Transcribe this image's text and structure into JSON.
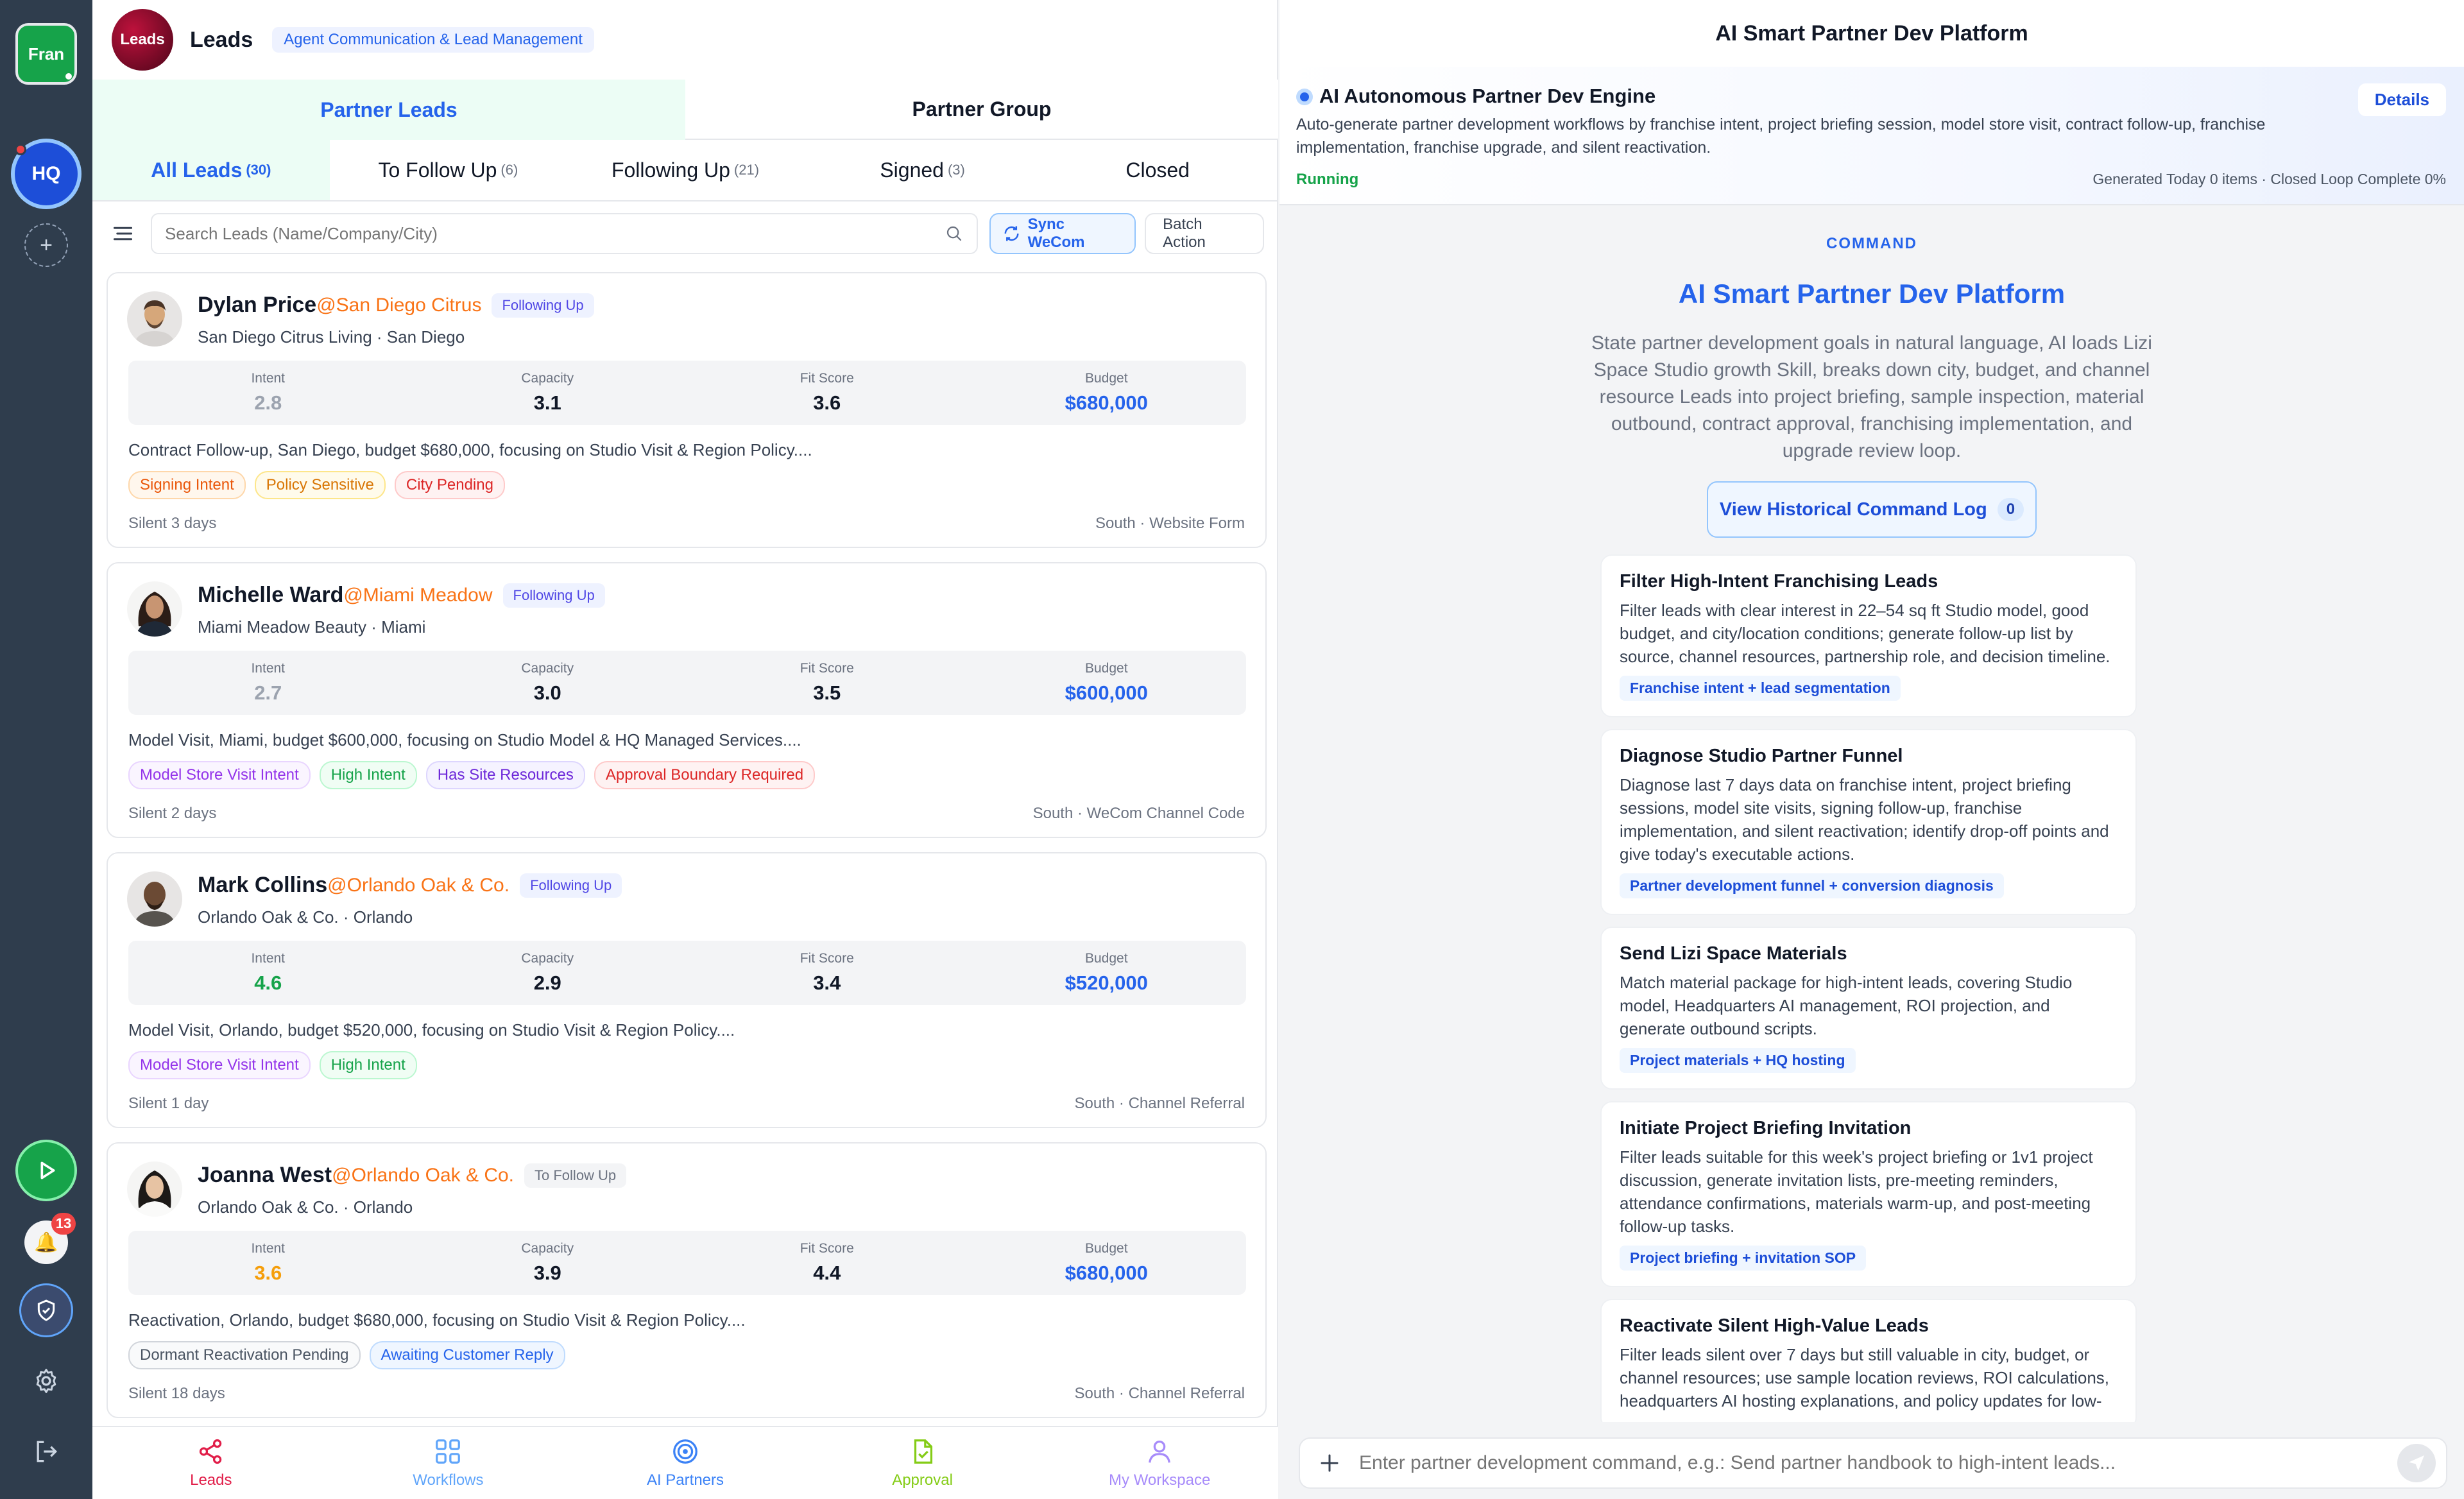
{
  "rail": {
    "account_label": "Fran",
    "hq_label": "HQ",
    "add_icon": "plus-icon",
    "notification_count": "13"
  },
  "header": {
    "logo_text": "Leads",
    "title": "Leads",
    "subtitle": "Agent Communication & Lead Management"
  },
  "segments": [
    "Partner Leads",
    "Partner Group"
  ],
  "tabs": [
    {
      "label": "All Leads",
      "count": "(30)"
    },
    {
      "label": "To Follow Up",
      "count": "(6)"
    },
    {
      "label": "Following Up",
      "count": "(21)"
    },
    {
      "label": "Signed",
      "count": "(3)"
    },
    {
      "label": "Closed",
      "count": ""
    }
  ],
  "toolbar": {
    "search_placeholder": "Search Leads (Name/Company/City)",
    "sync_label": "Sync WeCom",
    "batch_label": "Batch Action"
  },
  "metric_labels": {
    "intent": "Intent",
    "capacity": "Capacity",
    "fit": "Fit Score",
    "budget": "Budget"
  },
  "leads": [
    {
      "name": "Dylan Price",
      "company": "@San Diego Citrus",
      "status": "Following Up",
      "sub": "San Diego Citrus Living · San Diego",
      "intent": "2.8",
      "intent_color": "#9ca3af",
      "capacity": "3.1",
      "fit": "3.6",
      "budget": "$680,000",
      "desc": "Contract Follow-up, San Diego, budget $680,000, focusing on Studio Visit & Region Policy....",
      "tags": [
        "Signing Intent",
        "Policy Sensitive",
        "City Pending"
      ],
      "silent": "Silent 3 days",
      "source": "South · Website Form"
    },
    {
      "name": "Michelle Ward",
      "company": "@Miami Meadow",
      "status": "Following Up",
      "sub": "Miami Meadow Beauty · Miami",
      "intent": "2.7",
      "intent_color": "#9ca3af",
      "capacity": "3.0",
      "fit": "3.5",
      "budget": "$600,000",
      "desc": "Model Visit, Miami, budget $600,000, focusing on Studio Model & HQ Managed Services....",
      "tags": [
        "Model Store Visit Intent",
        "High Intent",
        "Has Site Resources",
        "Approval Boundary Required"
      ],
      "silent": "Silent 2 days",
      "source": "South · WeCom Channel Code"
    },
    {
      "name": "Mark Collins",
      "company": "@Orlando Oak & Co.",
      "status": "Following Up",
      "sub": "Orlando Oak & Co. · Orlando",
      "intent": "4.6",
      "intent_color": "#16a34a",
      "capacity": "2.9",
      "fit": "3.4",
      "budget": "$520,000",
      "desc": "Model Visit, Orlando, budget $520,000, focusing on Studio Visit & Region Policy....",
      "tags": [
        "Model Store Visit Intent",
        "High Intent"
      ],
      "silent": "Silent 1 day",
      "source": "South · Channel Referral"
    },
    {
      "name": "Joanna West",
      "company": "@Orlando Oak & Co.",
      "status": "To Follow Up",
      "sub": "Orlando Oak & Co. · Orlando",
      "intent": "3.6",
      "intent_color": "#f59e0b",
      "capacity": "3.9",
      "fit": "4.4",
      "budget": "$680,000",
      "desc": "Reactivation, Orlando, budget $680,000, focusing on Studio Visit & Region Policy....",
      "tags": [
        "Dormant Reactivation Pending",
        "Awaiting Customer Reply"
      ],
      "silent": "Silent 18 days",
      "source": "South · Channel Referral"
    }
  ],
  "bottom_nav": [
    {
      "label": "Leads",
      "color": "#e11d48"
    },
    {
      "label": "Workflows",
      "color": "#60a5fa"
    },
    {
      "label": "AI Partners",
      "color": "#3b82f6"
    },
    {
      "label": "Approval",
      "color": "#84cc16"
    },
    {
      "label": "My Workspace",
      "color": "#a78bfa"
    }
  ],
  "right": {
    "title": "AI Smart Partner Dev Platform",
    "engine": {
      "title": "AI Autonomous Partner Dev Engine",
      "desc": "Auto-generate partner development workflows by franchise intent, project briefing session, model store visit, contract follow-up, franchise implementation, franchise upgrade, and silent reactivation.",
      "status": "Running",
      "stats": "Generated Today 0 items · Closed Loop Complete 0%",
      "details": "Details"
    },
    "command_label": "COMMAND",
    "command_title": "AI Smart Partner Dev Platform",
    "command_desc": "State partner development goals in natural language, AI loads Lizi Space Studio growth Skill, breaks down city, budget, and channel resource Leads into project briefing, sample inspection, material outbound, contract approval, franchising implementation, and upgrade review loop.",
    "history_label": "View Historical Command Log",
    "history_count": "0",
    "skills": [
      {
        "title": "Filter High-Intent Franchising Leads",
        "desc": "Filter leads with clear interest in 22–54 sq ft Studio model, good budget, and city/location conditions; generate follow-up list by source, channel resources, partnership role, and decision timeline.",
        "chip": "Franchise intent + lead segmentation"
      },
      {
        "title": "Diagnose Studio Partner Funnel",
        "desc": "Diagnose last 7 days data on franchise intent, project briefing sessions, model site visits, signing follow-up, franchise implementation, and silent reactivation; identify drop-off points and give today's executable actions.",
        "chip": "Partner development funnel + conversion diagnosis"
      },
      {
        "title": "Send Lizi Space Materials",
        "desc": "Match material package for high-intent leads, covering Studio model, Headquarters AI management, ROI projection, and generate outbound scripts.",
        "chip": "Project materials + HQ hosting"
      },
      {
        "title": "Initiate Project Briefing Invitation",
        "desc": "Filter leads suitable for this week's project briefing or 1v1 project discussion, generate invitation lists, pre-meeting reminders, attendance confirmations, materials warm-up, and post-meeting follow-up tasks.",
        "chip": "Project briefing + invitation SOP"
      },
      {
        "title": "Reactivate Silent High-Value Leads",
        "desc": "Filter leads silent over 7 days but still valuable in city, budget, or channel resources; use sample location reviews, ROI calculations, headquarters AI hosting explanations, and policy updates for low-",
        "chip": ""
      }
    ],
    "composer_placeholder": "Enter partner development command, e.g.: Send partner handbook to high-intent leads..."
  }
}
